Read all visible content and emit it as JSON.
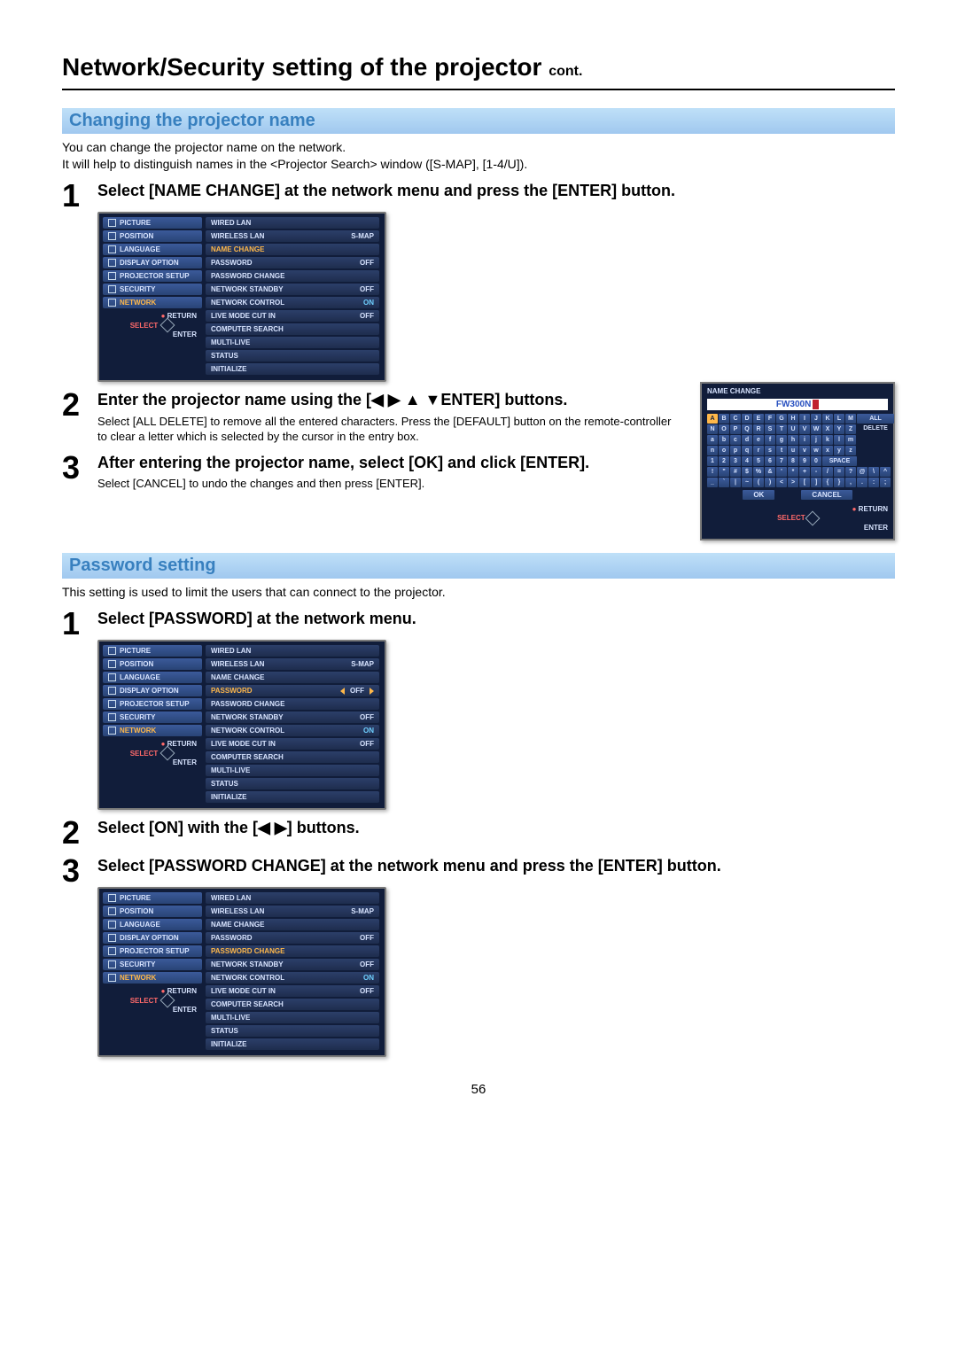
{
  "page_title": "Network/Security setting of the projector",
  "page_title_cont": "cont.",
  "page_number": "56",
  "section1": {
    "heading": "Changing the projector name",
    "desc": "You can change the projector name on the network.\nIt will help to distinguish names in the <Projector Search> window ([S-MAP], [1-4/U]).",
    "step1_head": "Select [NAME CHANGE] at the network menu and press the [ENTER] button.",
    "step2_head": "Enter the projector name using the [◀ ▶ ▲ ▼ENTER] buttons.",
    "step2_desc": "Select [ALL DELETE] to remove all the entered characters. Press the [DEFAULT] button on the remote-controller to clear a letter which is selected by the cursor in the entry box.",
    "step3_head": "After entering the projector name, select [OK] and click [ENTER].",
    "step3_desc": "Select [CANCEL] to undo the changes and then press [ENTER]."
  },
  "section2": {
    "heading": "Password setting",
    "desc": "This setting is used to limit the users that can connect to the projector.",
    "step1_head": "Select [PASSWORD] at the network menu.",
    "step2_head": "Select [ON] with the [◀ ▶] buttons.",
    "step3_head": "Select [PASSWORD CHANGE] at the network menu and press the [ENTER] button."
  },
  "osd_left_items": [
    "PICTURE",
    "POSITION",
    "LANGUAGE",
    "DISPLAY OPTION",
    "PROJECTOR SETUP",
    "SECURITY",
    "NETWORK"
  ],
  "osd_footer": {
    "return": "RETURN",
    "select": "SELECT",
    "enter": "ENTER"
  },
  "osd_right_a": [
    {
      "label": "WIRED LAN",
      "val": ""
    },
    {
      "label": "WIRELESS LAN",
      "val": "S-MAP"
    },
    {
      "label": "NAME CHANGE",
      "val": "",
      "hl": true
    },
    {
      "label": "PASSWORD",
      "val": "OFF"
    },
    {
      "label": "PASSWORD CHANGE",
      "val": ""
    },
    {
      "label": "NETWORK STANDBY",
      "val": "OFF"
    },
    {
      "label": "NETWORK CONTROL",
      "val": "ON"
    },
    {
      "label": "LIVE MODE CUT IN",
      "val": "OFF"
    },
    {
      "label": "COMPUTER SEARCH",
      "val": ""
    },
    {
      "label": "MULTI-LIVE",
      "val": ""
    },
    {
      "label": "STATUS",
      "val": ""
    },
    {
      "label": "INITIALIZE",
      "val": ""
    }
  ],
  "osd_right_b": [
    {
      "label": "WIRED LAN",
      "val": ""
    },
    {
      "label": "WIRELESS LAN",
      "val": "S-MAP"
    },
    {
      "label": "NAME CHANGE",
      "val": ""
    },
    {
      "label": "PASSWORD",
      "val": "OFF",
      "hl": true,
      "arrows": true
    },
    {
      "label": "PASSWORD CHANGE",
      "val": ""
    },
    {
      "label": "NETWORK STANDBY",
      "val": "OFF"
    },
    {
      "label": "NETWORK CONTROL",
      "val": "ON"
    },
    {
      "label": "LIVE MODE CUT IN",
      "val": "OFF"
    },
    {
      "label": "COMPUTER SEARCH",
      "val": ""
    },
    {
      "label": "MULTI-LIVE",
      "val": ""
    },
    {
      "label": "STATUS",
      "val": ""
    },
    {
      "label": "INITIALIZE",
      "val": ""
    }
  ],
  "osd_right_c": [
    {
      "label": "WIRED LAN",
      "val": ""
    },
    {
      "label": "WIRELESS LAN",
      "val": "S-MAP"
    },
    {
      "label": "NAME CHANGE",
      "val": ""
    },
    {
      "label": "PASSWORD",
      "val": "OFF"
    },
    {
      "label": "PASSWORD CHANGE",
      "val": "",
      "hl": true
    },
    {
      "label": "NETWORK STANDBY",
      "val": "OFF"
    },
    {
      "label": "NETWORK CONTROL",
      "val": "ON"
    },
    {
      "label": "LIVE MODE CUT IN",
      "val": "OFF"
    },
    {
      "label": "COMPUTER SEARCH",
      "val": ""
    },
    {
      "label": "MULTI-LIVE",
      "val": ""
    },
    {
      "label": "STATUS",
      "val": ""
    },
    {
      "label": "INITIALIZE",
      "val": ""
    }
  ],
  "keypad": {
    "title": "NAME CHANGE",
    "value": "FW300N",
    "rows_upper": [
      "A",
      "B",
      "C",
      "D",
      "E",
      "F",
      "G",
      "H",
      "I",
      "J",
      "K",
      "L",
      "M"
    ],
    "rows_upper2": [
      "N",
      "O",
      "P",
      "Q",
      "R",
      "S",
      "T",
      "U",
      "V",
      "W",
      "X",
      "Y",
      "Z"
    ],
    "rows_lower": [
      "a",
      "b",
      "c",
      "d",
      "e",
      "f",
      "g",
      "h",
      "i",
      "j",
      "k",
      "l",
      "m"
    ],
    "rows_lower2": [
      "n",
      "o",
      "p",
      "q",
      "r",
      "s",
      "t",
      "u",
      "v",
      "w",
      "x",
      "y",
      "z"
    ],
    "rows_num": [
      "1",
      "2",
      "3",
      "4",
      "5",
      "6",
      "7",
      "8",
      "9",
      "0"
    ],
    "rows_sym": [
      "!",
      "\"",
      "#",
      "$",
      "%",
      "&",
      "'",
      "*",
      "+",
      "-",
      "/",
      "=",
      "?",
      "@",
      "\\",
      "^"
    ],
    "rows_sym2": [
      "_",
      "`",
      "|",
      "~",
      "(",
      ")",
      "<",
      ">",
      "[",
      "]",
      "{",
      "}",
      ",",
      ".",
      ":",
      ";"
    ],
    "all_delete": "ALL DELETE",
    "space": "SPACE",
    "ok": "OK",
    "cancel": "CANCEL",
    "return": "RETURN",
    "select": "SELECT",
    "enter": "ENTER"
  }
}
